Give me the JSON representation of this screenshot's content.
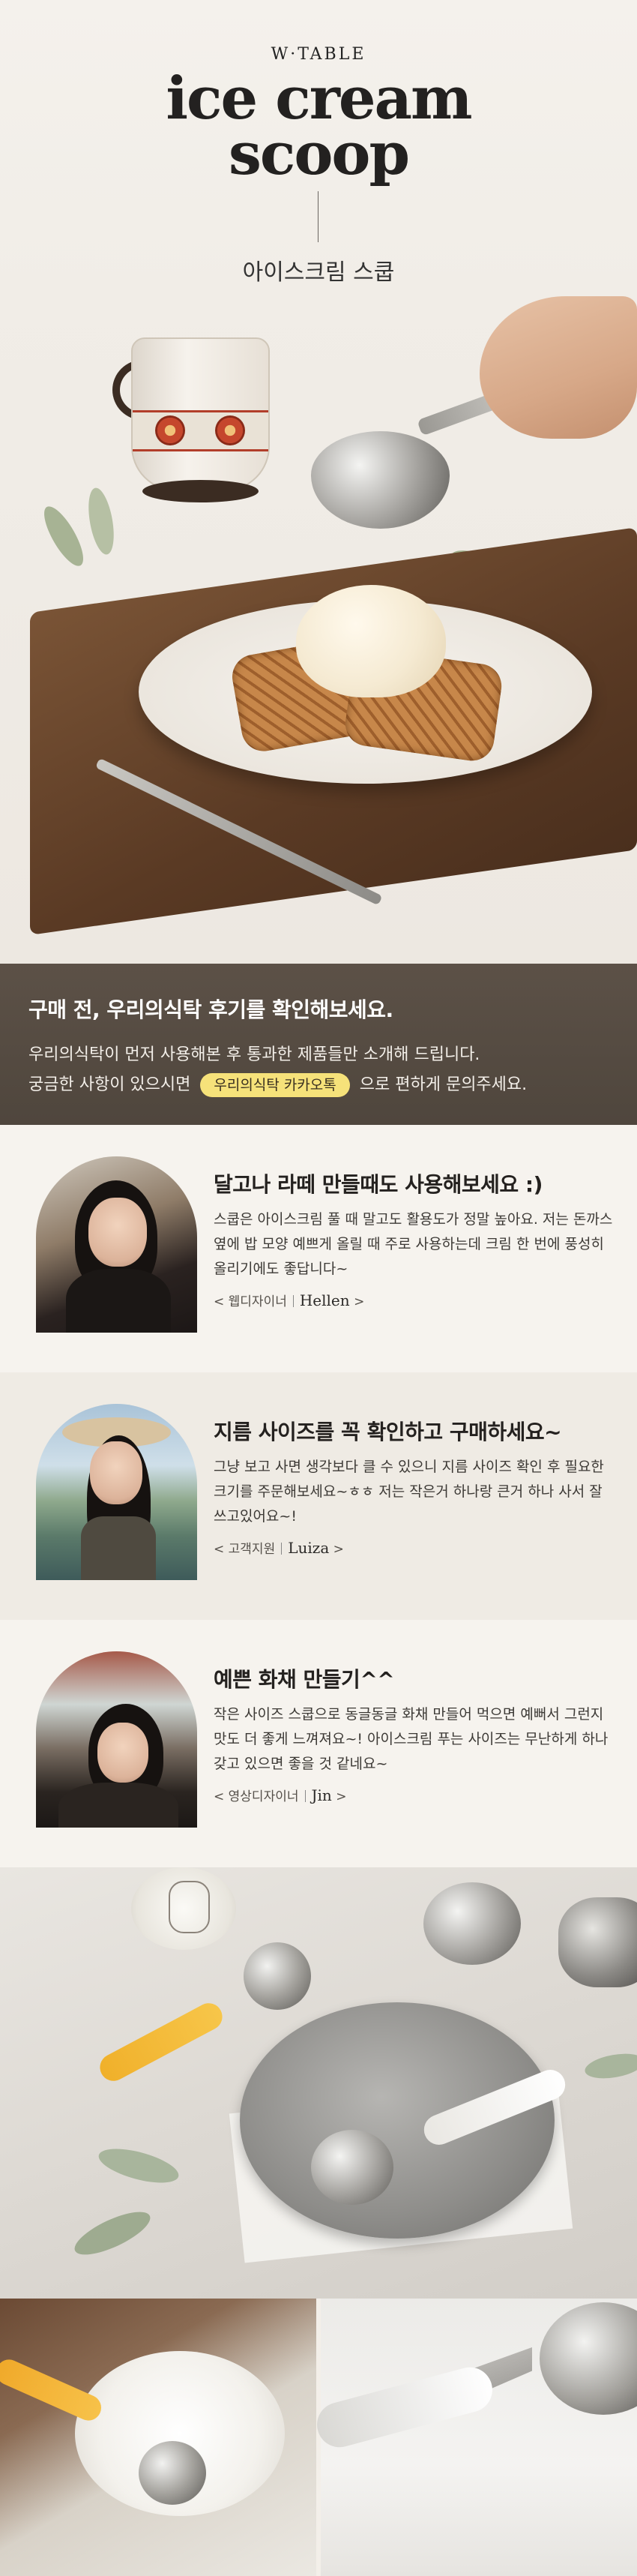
{
  "hero": {
    "brand": "W·TABLE",
    "title_line1": "ice cream",
    "title_line2": "scoop",
    "subtitle": "아이스크림 스쿱"
  },
  "banner": {
    "heading": "구매 전, 우리의식탁 후기를 확인해보세요.",
    "line1": "우리의식탁이 먼저 사용해본 후 통과한 제품들만 소개해 드립니다.",
    "line2_prefix": "궁금한 사항이 있으시면",
    "kakao_label": "우리의식탁 카카오톡",
    "line2_suffix": "으로 편하게 문의주세요."
  },
  "reviews": [
    {
      "title": "달고나 라떼 만들때도 사용해보세요 :)",
      "body": "스쿱은 아이스크림 풀 때 말고도 활용도가 정말 높아요. 저는 돈까스 옆에 밥 모양 예쁘게 올릴 때 주로 사용하는데 크림 한 번에 풍성히 올리기에도 좋답니다~",
      "role": "< 웹디자이너",
      "name": "Hellen",
      "close": ">"
    },
    {
      "title": "지름 사이즈를 꼭 확인하고 구매하세요~",
      "body": "그냥 보고 사면 생각보다 클 수 있으니 지름 사이즈 확인 후 필요한 크기를 주문해보세요~ㅎㅎ 저는 작은거 하나랑 큰거 하나 사서 잘 쓰고있어요~!",
      "role": "< 고객지원",
      "name": "Luiza",
      "close": ">"
    },
    {
      "title": "예쁜 화채 만들기^^",
      "body": "작은 사이즈 스쿱으로 동글동글 화채 만들어 먹으면 예뻐서 그런지 맛도 더 좋게 느껴져요~! 아이스크림 푸는 사이즈는 무난하게 하나 갖고 있으면 좋을 것 같네요~",
      "role": "< 영상디자이너",
      "name": "Jin",
      "close": ">"
    }
  ],
  "colors": {
    "banner_bg": "#544a41",
    "kakao_badge": "#f6e27a",
    "page_bg": "#f3efe9"
  }
}
